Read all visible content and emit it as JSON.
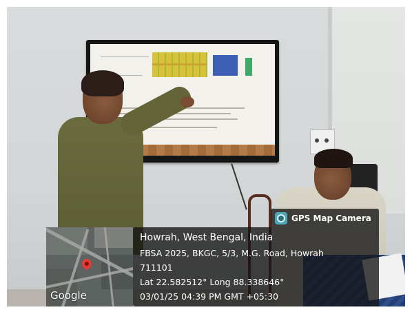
{
  "overlay": {
    "app_name": "GPS Map Camera",
    "app_icon": "camera-icon",
    "location_title": "Howrah, West Bengal, India",
    "address_line1": "FBSA 2025, BKGC, 5/3, M.G. Road, Howrah",
    "address_line2": "711101",
    "coordinates": "Lat 22.582512° Long 88.338646°",
    "datetime": "03/01/25 04:39 PM GMT +05:30"
  },
  "map": {
    "logo": "Google",
    "pin_icon": "location-pin-icon",
    "pin_color": "#e53935"
  }
}
